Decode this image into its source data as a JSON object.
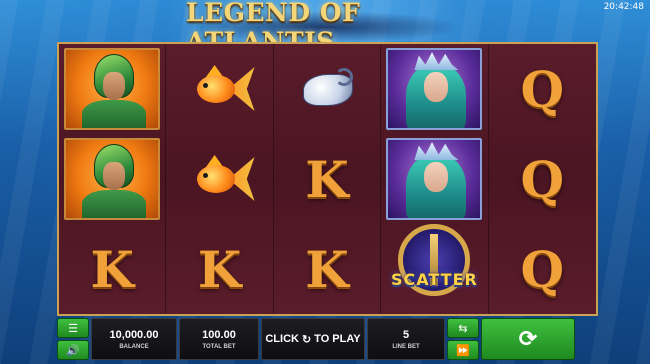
{
  "clock": "20:42:48",
  "logo": {
    "text": "LEGEND OF ATLANTIS"
  },
  "reels": [
    [
      "warrior",
      "warrior",
      "K"
    ],
    [
      "goldfish",
      "goldfish",
      "K"
    ],
    [
      "shell",
      "K",
      "K"
    ],
    [
      "queen",
      "queen",
      "scatter"
    ],
    [
      "Q",
      "Q",
      "Q"
    ]
  ],
  "symbols": {
    "K": "K",
    "Q": "Q",
    "scatter": "SCATTER"
  },
  "bar": {
    "menu_icon": "hamburger-menu-icon",
    "sound_icon": "speaker-icon",
    "balance_value": "10,000.00",
    "balance_label": "BALANCE",
    "total_bet_value": "100.00",
    "total_bet_label": "TOTAL BET",
    "play_prefix": "CLICK",
    "play_suffix": "TO PLAY",
    "line_bet_value": "5",
    "line_bet_label": "LINE BET",
    "autoplay_icon": "autoplay-icon",
    "turbo_icon": "fast-forward-icon",
    "spin_icon": "spin-icon"
  },
  "colors": {
    "accent_green": "#2aa52a",
    "reel_background": "#4b1522",
    "letter_orange": "#f0a13a",
    "scatter_gold": "#ffd24a"
  }
}
